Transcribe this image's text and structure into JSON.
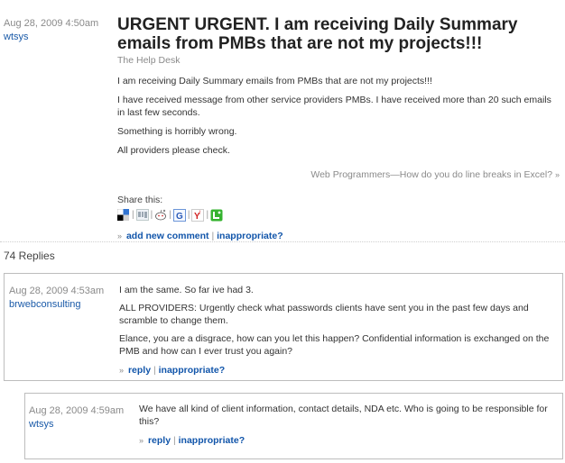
{
  "post": {
    "date": "Aug 28, 2009 4:50am",
    "author": "wtsys",
    "title": "URGENT URGENT. I am receiving Daily Summary emails from PMBs that are not my projects!!!",
    "category": "The Help Desk",
    "paragraphs": [
      "I am receiving Daily Summary emails from PMBs that are not my projects!!!",
      "I have received message from other service providers PMBs. I have received more than 20 such emails in last few seconds.",
      "Something is horribly wrong.",
      "All providers please check."
    ],
    "nav": {
      "prev": "Web Programmers",
      "dash": "—",
      "next": "How do you do line breaks in Excel?",
      "arrow": "»"
    },
    "share_label": "Share this:",
    "share_icons": [
      "delicious-icon",
      "digg-icon",
      "reddit-icon",
      "google-icon",
      "yahoo-icon",
      "technorati-icon"
    ],
    "actions": {
      "arrow": "»",
      "add_comment": "add new comment",
      "sep": "|",
      "inappropriate": "inappropriate?"
    }
  },
  "replies_label": "74 Replies",
  "replies": [
    {
      "date": "Aug 28, 2009 4:53am",
      "author": "brwebconsulting",
      "paragraphs": [
        "I am the same. So far ive had 3.",
        "ALL PROVIDERS: Urgently check what passwords clients have sent you in the past few days and scramble to change them.",
        "Elance, you are a disgrace, how can you let this happen? Confidential information is exchanged on the PMB and how can I ever trust you again?"
      ],
      "reply": "reply",
      "sep": "|",
      "inappropriate": "inappropriate?",
      "arrow": "»"
    },
    {
      "date": "Aug 28, 2009 4:59am",
      "author": "wtsys",
      "paragraphs": [
        "We have all kind of client information, contact details, NDA etc. Who is going to be responsible for this?"
      ],
      "reply": "reply",
      "sep": "|",
      "inappropriate": "inappropriate?",
      "arrow": "»"
    }
  ],
  "colors": {
    "link": "#1155aa",
    "meta": "#8a8a8a",
    "border": "#bdbdbd"
  }
}
